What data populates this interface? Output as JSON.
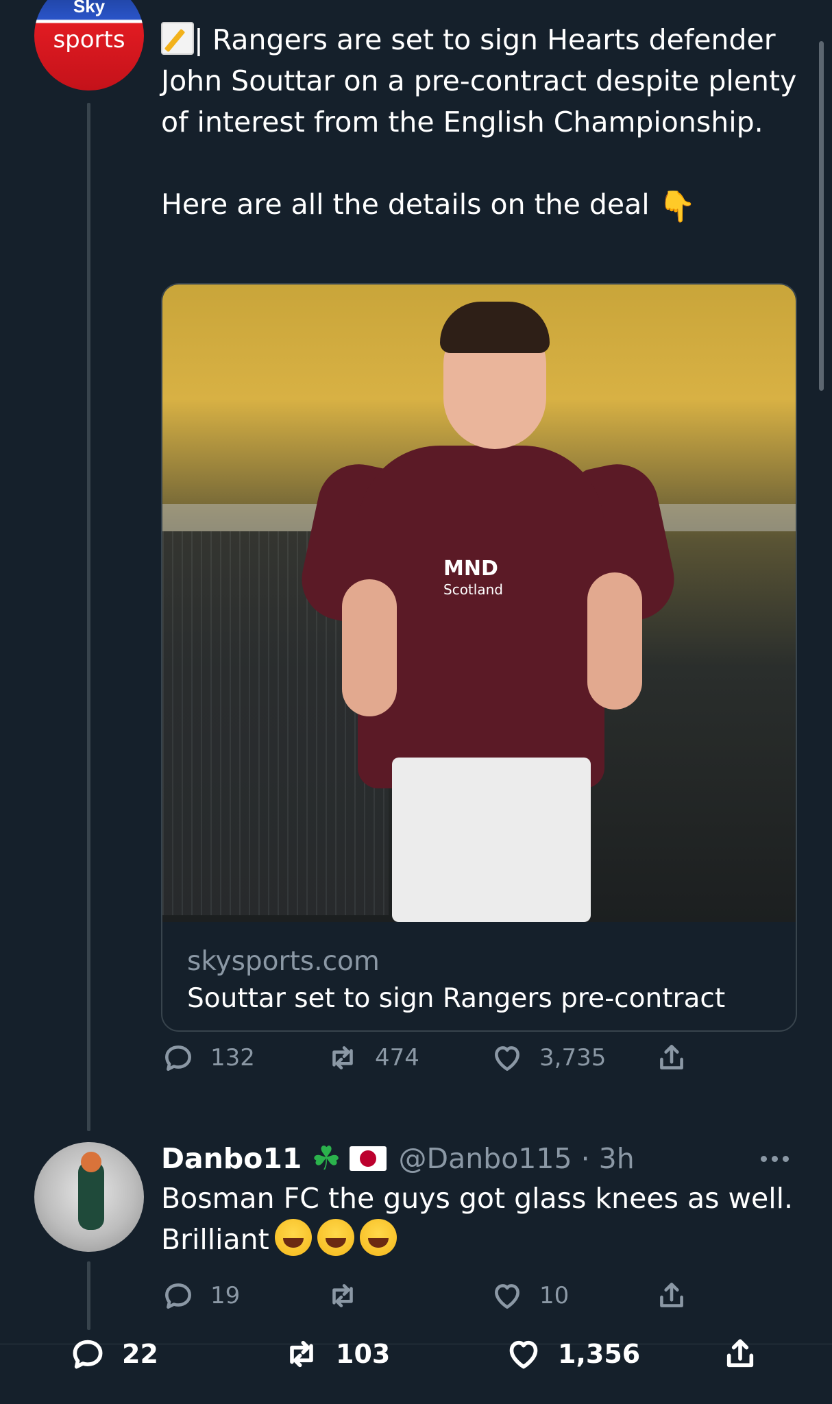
{
  "tweet": {
    "avatar": {
      "brand_top": "Sky",
      "brand_bottom": "sports",
      "colors": [
        "#2a54c8",
        "#e11b22"
      ]
    },
    "text_line_1": "| Rangers are set to sign Hearts defender John Souttar on a pre-contract despite plenty of interest from the English Championship.",
    "text_line_2": "Here are all the details on the deal",
    "emoji_lead": "memo-icon",
    "emoji_trail": "backhand-index-pointing-down-icon",
    "card": {
      "image_sponsor_top": "MND",
      "image_sponsor_bottom": "Scotland",
      "domain": "skysports.com",
      "title": "Souttar set to sign Rangers pre-contract"
    },
    "stats": {
      "replies": "132",
      "retweets": "474",
      "likes": "3,735"
    }
  },
  "reply": {
    "name": "Danbo11",
    "handle": "@Danbo115 · 3h",
    "badges": [
      "shamrock-icon",
      "japan-flag-icon"
    ],
    "text_line_1": "Bosman FC the guys got glass knees as well.",
    "text_line_2": "Brilliant",
    "emojis": [
      "laughing-tears-icon",
      "laughing-tears-icon",
      "laughing-tears-icon"
    ],
    "stats": {
      "replies": "19",
      "retweets": "",
      "likes": "10"
    }
  },
  "bottom_bar": {
    "replies": "22",
    "retweets": "103",
    "likes": "1,356"
  },
  "colors": {
    "background": "#15202b",
    "muted_text": "#8b98a5",
    "border": "#38444d"
  }
}
